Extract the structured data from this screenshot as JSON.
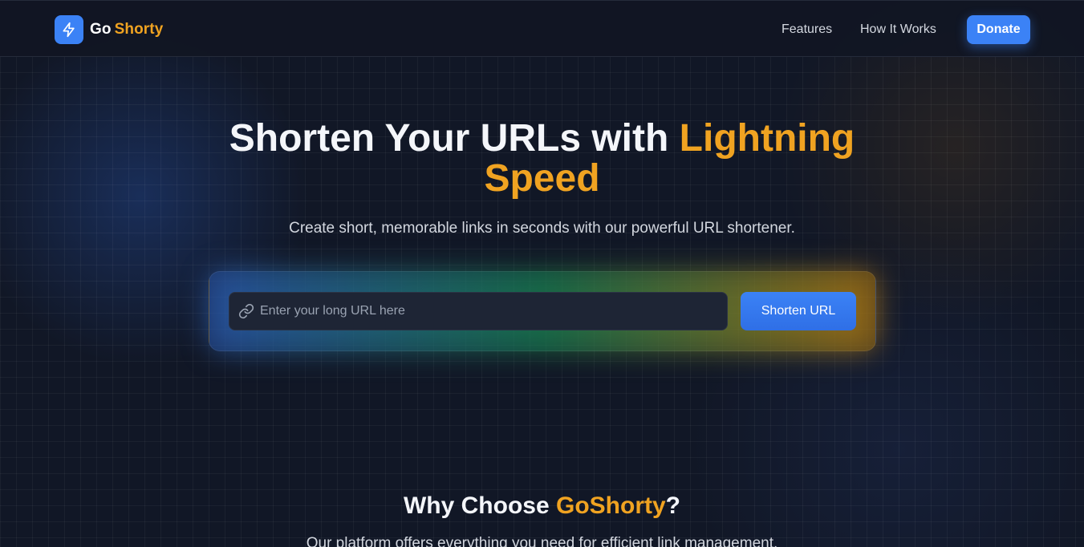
{
  "header": {
    "brand_go": "Go",
    "brand_shorty": "Shorty",
    "logo_icon": "lightning-icon",
    "nav": [
      "Features",
      "How It Works"
    ],
    "donate_label": "Donate"
  },
  "hero": {
    "title_main": "Shorten Your URLs with ",
    "title_accent_1": "Lightning",
    "title_accent_2": "Speed",
    "subtitle": "Create short, memorable links in seconds with our powerful URL shortener."
  },
  "form": {
    "link_icon": "link-icon",
    "url_placeholder": "Enter your long URL here",
    "url_value": "",
    "button_label": "Shorten URL"
  },
  "why": {
    "title_main": "Why Choose ",
    "title_accent": "GoShorty",
    "title_end": "?",
    "subtitle": "Our platform offers everything you need for efficient link management."
  },
  "colors": {
    "background": "#111726",
    "primary": "#3b82f6",
    "accent": "#f0a321"
  }
}
